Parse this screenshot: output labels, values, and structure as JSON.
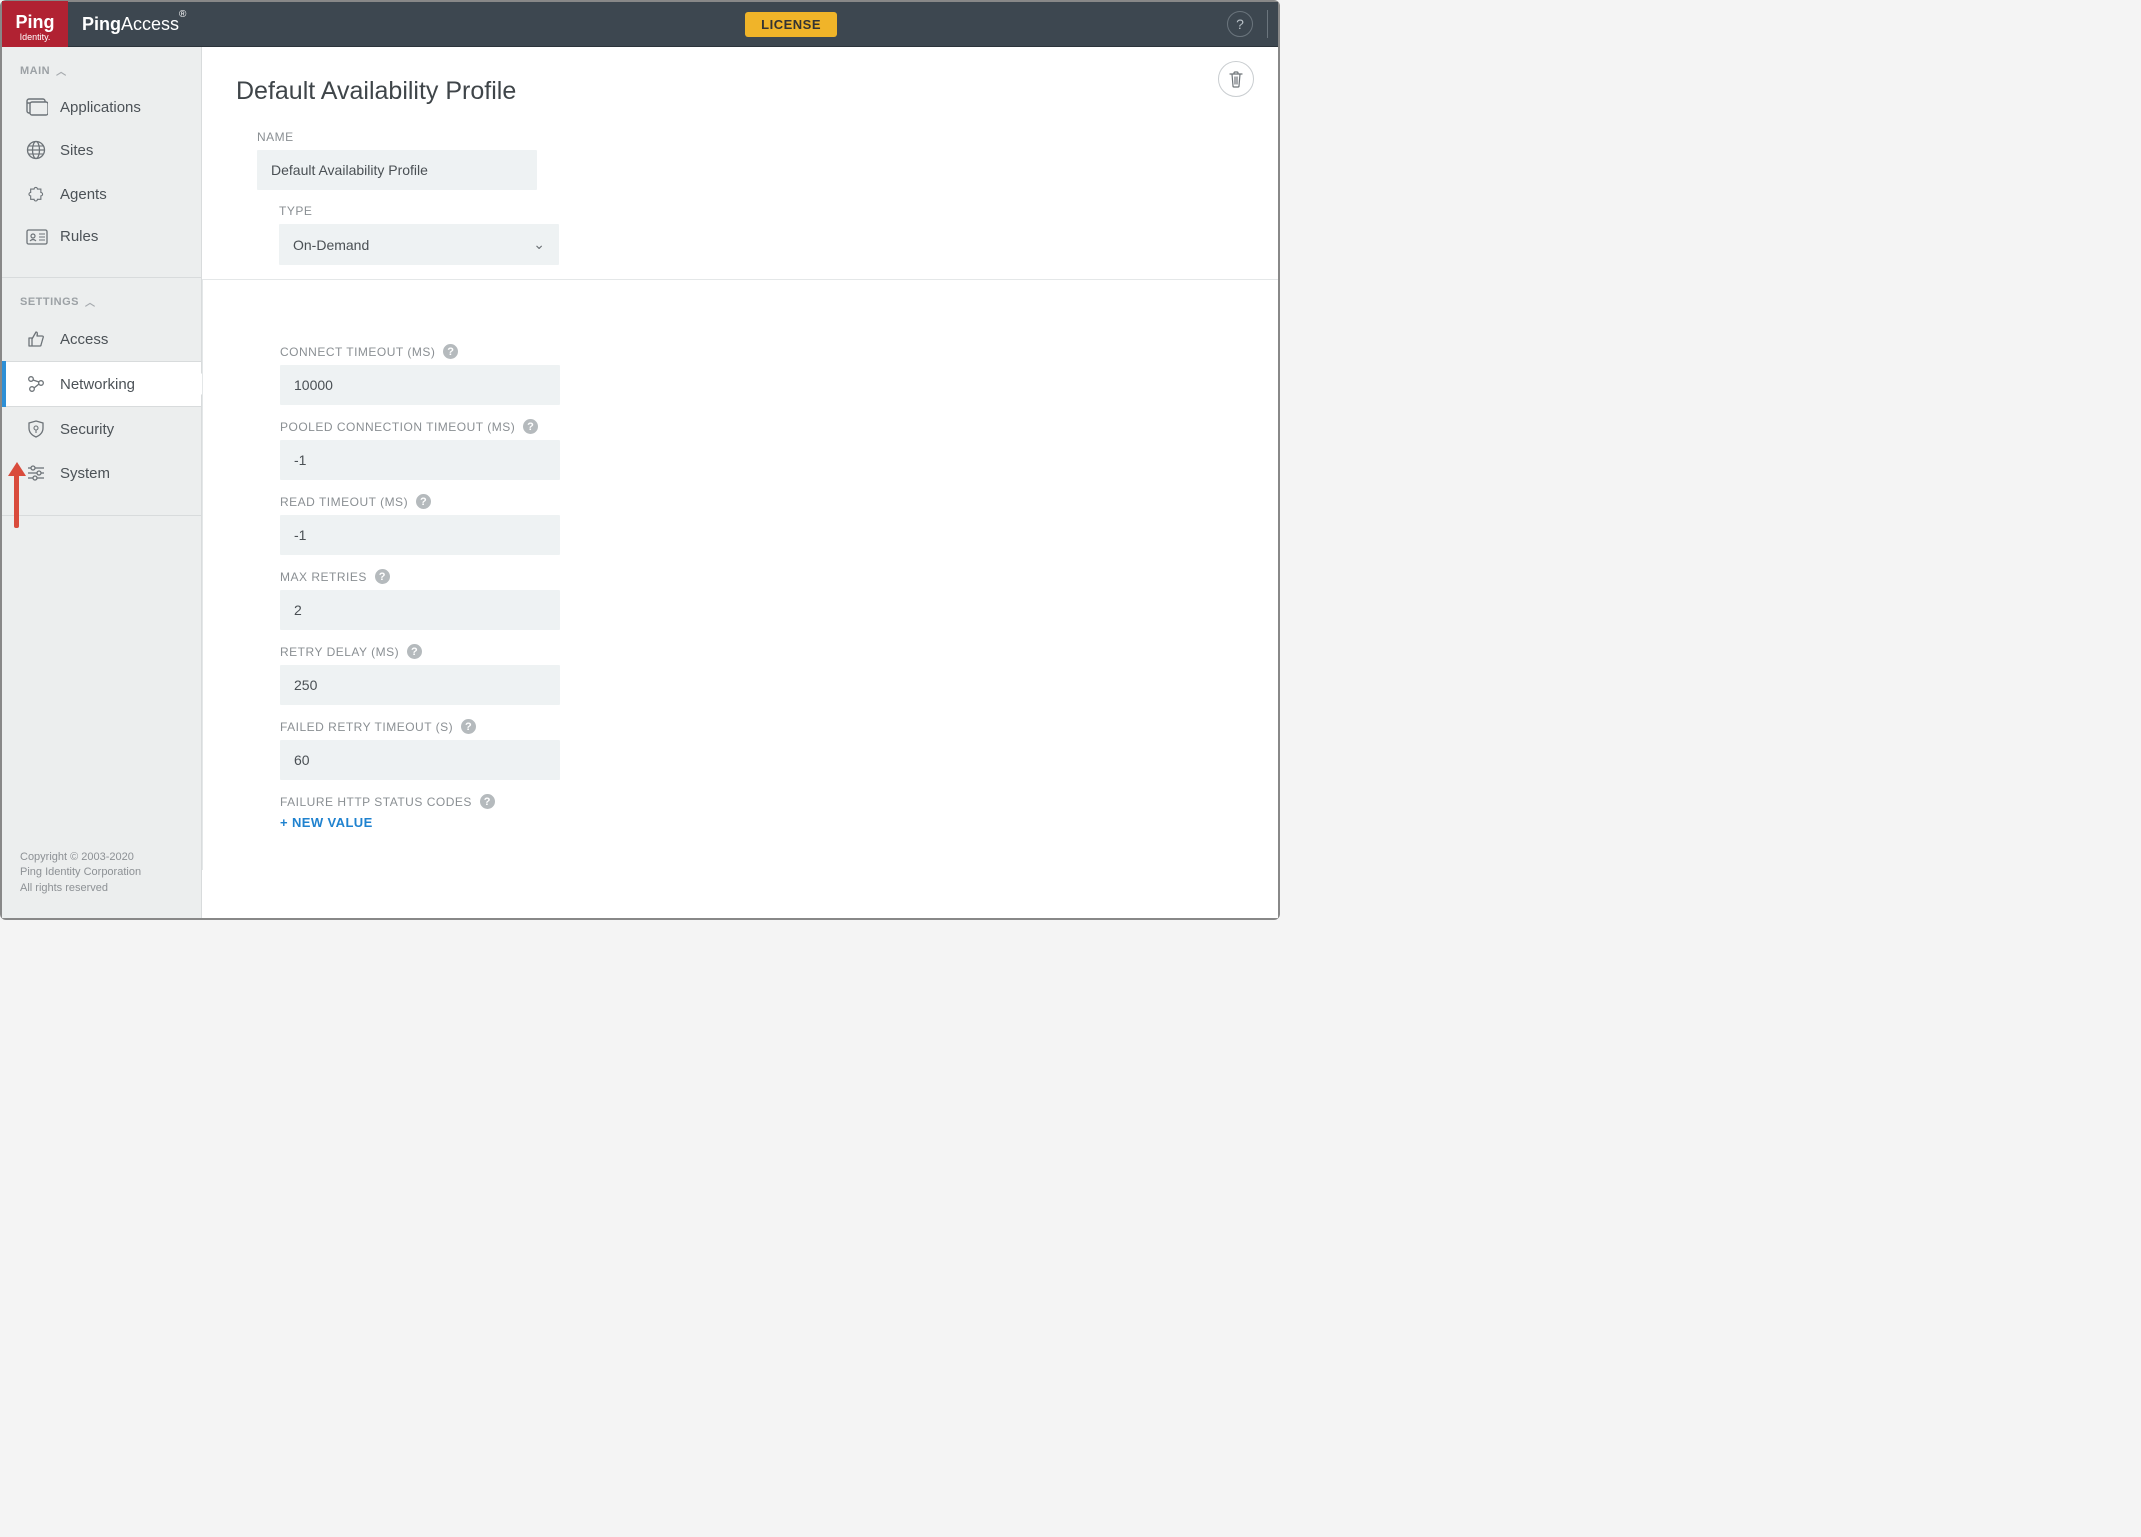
{
  "brand": {
    "logo_top": "Ping",
    "logo_bottom": "Identity.",
    "product_prefix": "Ping",
    "product_suffix": "Access"
  },
  "topbar": {
    "license_label": "LICENSE"
  },
  "sidebar": {
    "section_main": "MAIN",
    "section_settings": "SETTINGS",
    "items_main": [
      {
        "label": "Applications"
      },
      {
        "label": "Sites"
      },
      {
        "label": "Agents"
      },
      {
        "label": "Rules"
      }
    ],
    "items_settings": [
      {
        "label": "Access"
      },
      {
        "label": "Networking"
      },
      {
        "label": "Security"
      },
      {
        "label": "System"
      }
    ]
  },
  "footer": {
    "line1": "Copyright © 2003-2020",
    "line2": "Ping Identity Corporation",
    "line3": "All rights reserved"
  },
  "page": {
    "title": "Default Availability Profile",
    "labels": {
      "name": "NAME",
      "type": "TYPE",
      "connect_timeout": "CONNECT TIMEOUT (MS)",
      "pooled_connection_timeout": "POOLED CONNECTION TIMEOUT (MS)",
      "read_timeout": "READ TIMEOUT (MS)",
      "max_retries": "MAX RETRIES",
      "retry_delay": "RETRY DELAY (MS)",
      "failed_retry_timeout": "FAILED RETRY TIMEOUT (S)",
      "failure_http_status_codes": "FAILURE HTTP STATUS CODES"
    },
    "values": {
      "name": "Default Availability Profile",
      "type": "On-Demand",
      "connect_timeout": "10000",
      "pooled_connection_timeout": "-1",
      "read_timeout": "-1",
      "max_retries": "2",
      "retry_delay": "250",
      "failed_retry_timeout": "60"
    },
    "new_value_label": "+ NEW VALUE"
  }
}
